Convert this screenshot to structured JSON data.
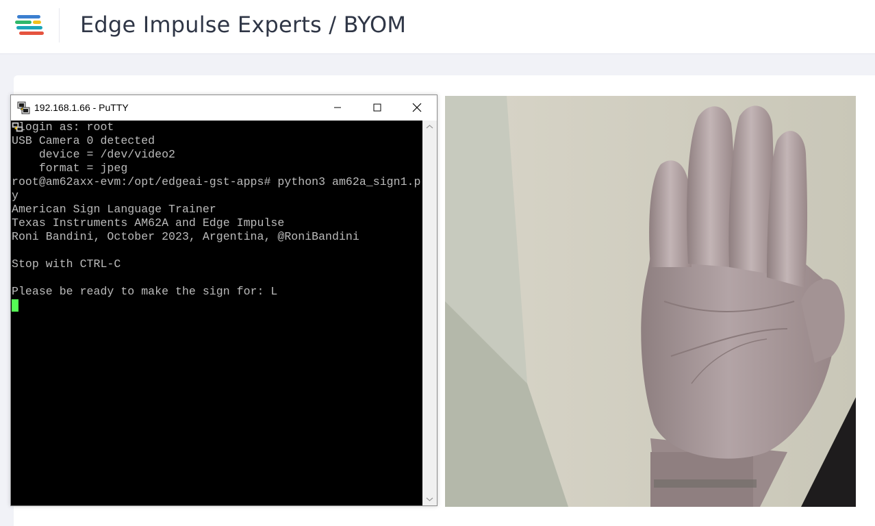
{
  "header": {
    "title": "Edge Impulse Experts / BYOM"
  },
  "putty": {
    "title": "192.168.1.66 - PuTTY",
    "lines": [
      " login as: root",
      "USB Camera 0 detected",
      "    device = /dev/video2",
      "    format = jpeg",
      "root@am62axx-evm:/opt/edgeai-gst-apps# python3 am62a_sign1.p",
      "y",
      "American Sign Language Trainer",
      "Texas Instruments AM62A and Edge Impulse",
      "Roni Bandini, October 2023, Argentina, @RoniBandini",
      "",
      "Stop with CTRL-C",
      "",
      "Please be ready to make the sign for: L"
    ]
  },
  "colors": {
    "terminal_bg": "#000000",
    "terminal_text": "#bbbbbb",
    "cursor": "#55ff55",
    "logo_blue": "#3b7fd0",
    "logo_green": "#2fb86a",
    "logo_yellow": "#f3c21d",
    "logo_red": "#e5533f"
  },
  "icons": {
    "logo": "edge-impulse-logo-icon",
    "app": "putty-icon",
    "minimize": "minimize-icon",
    "maximize": "maximize-icon",
    "close": "close-icon"
  }
}
